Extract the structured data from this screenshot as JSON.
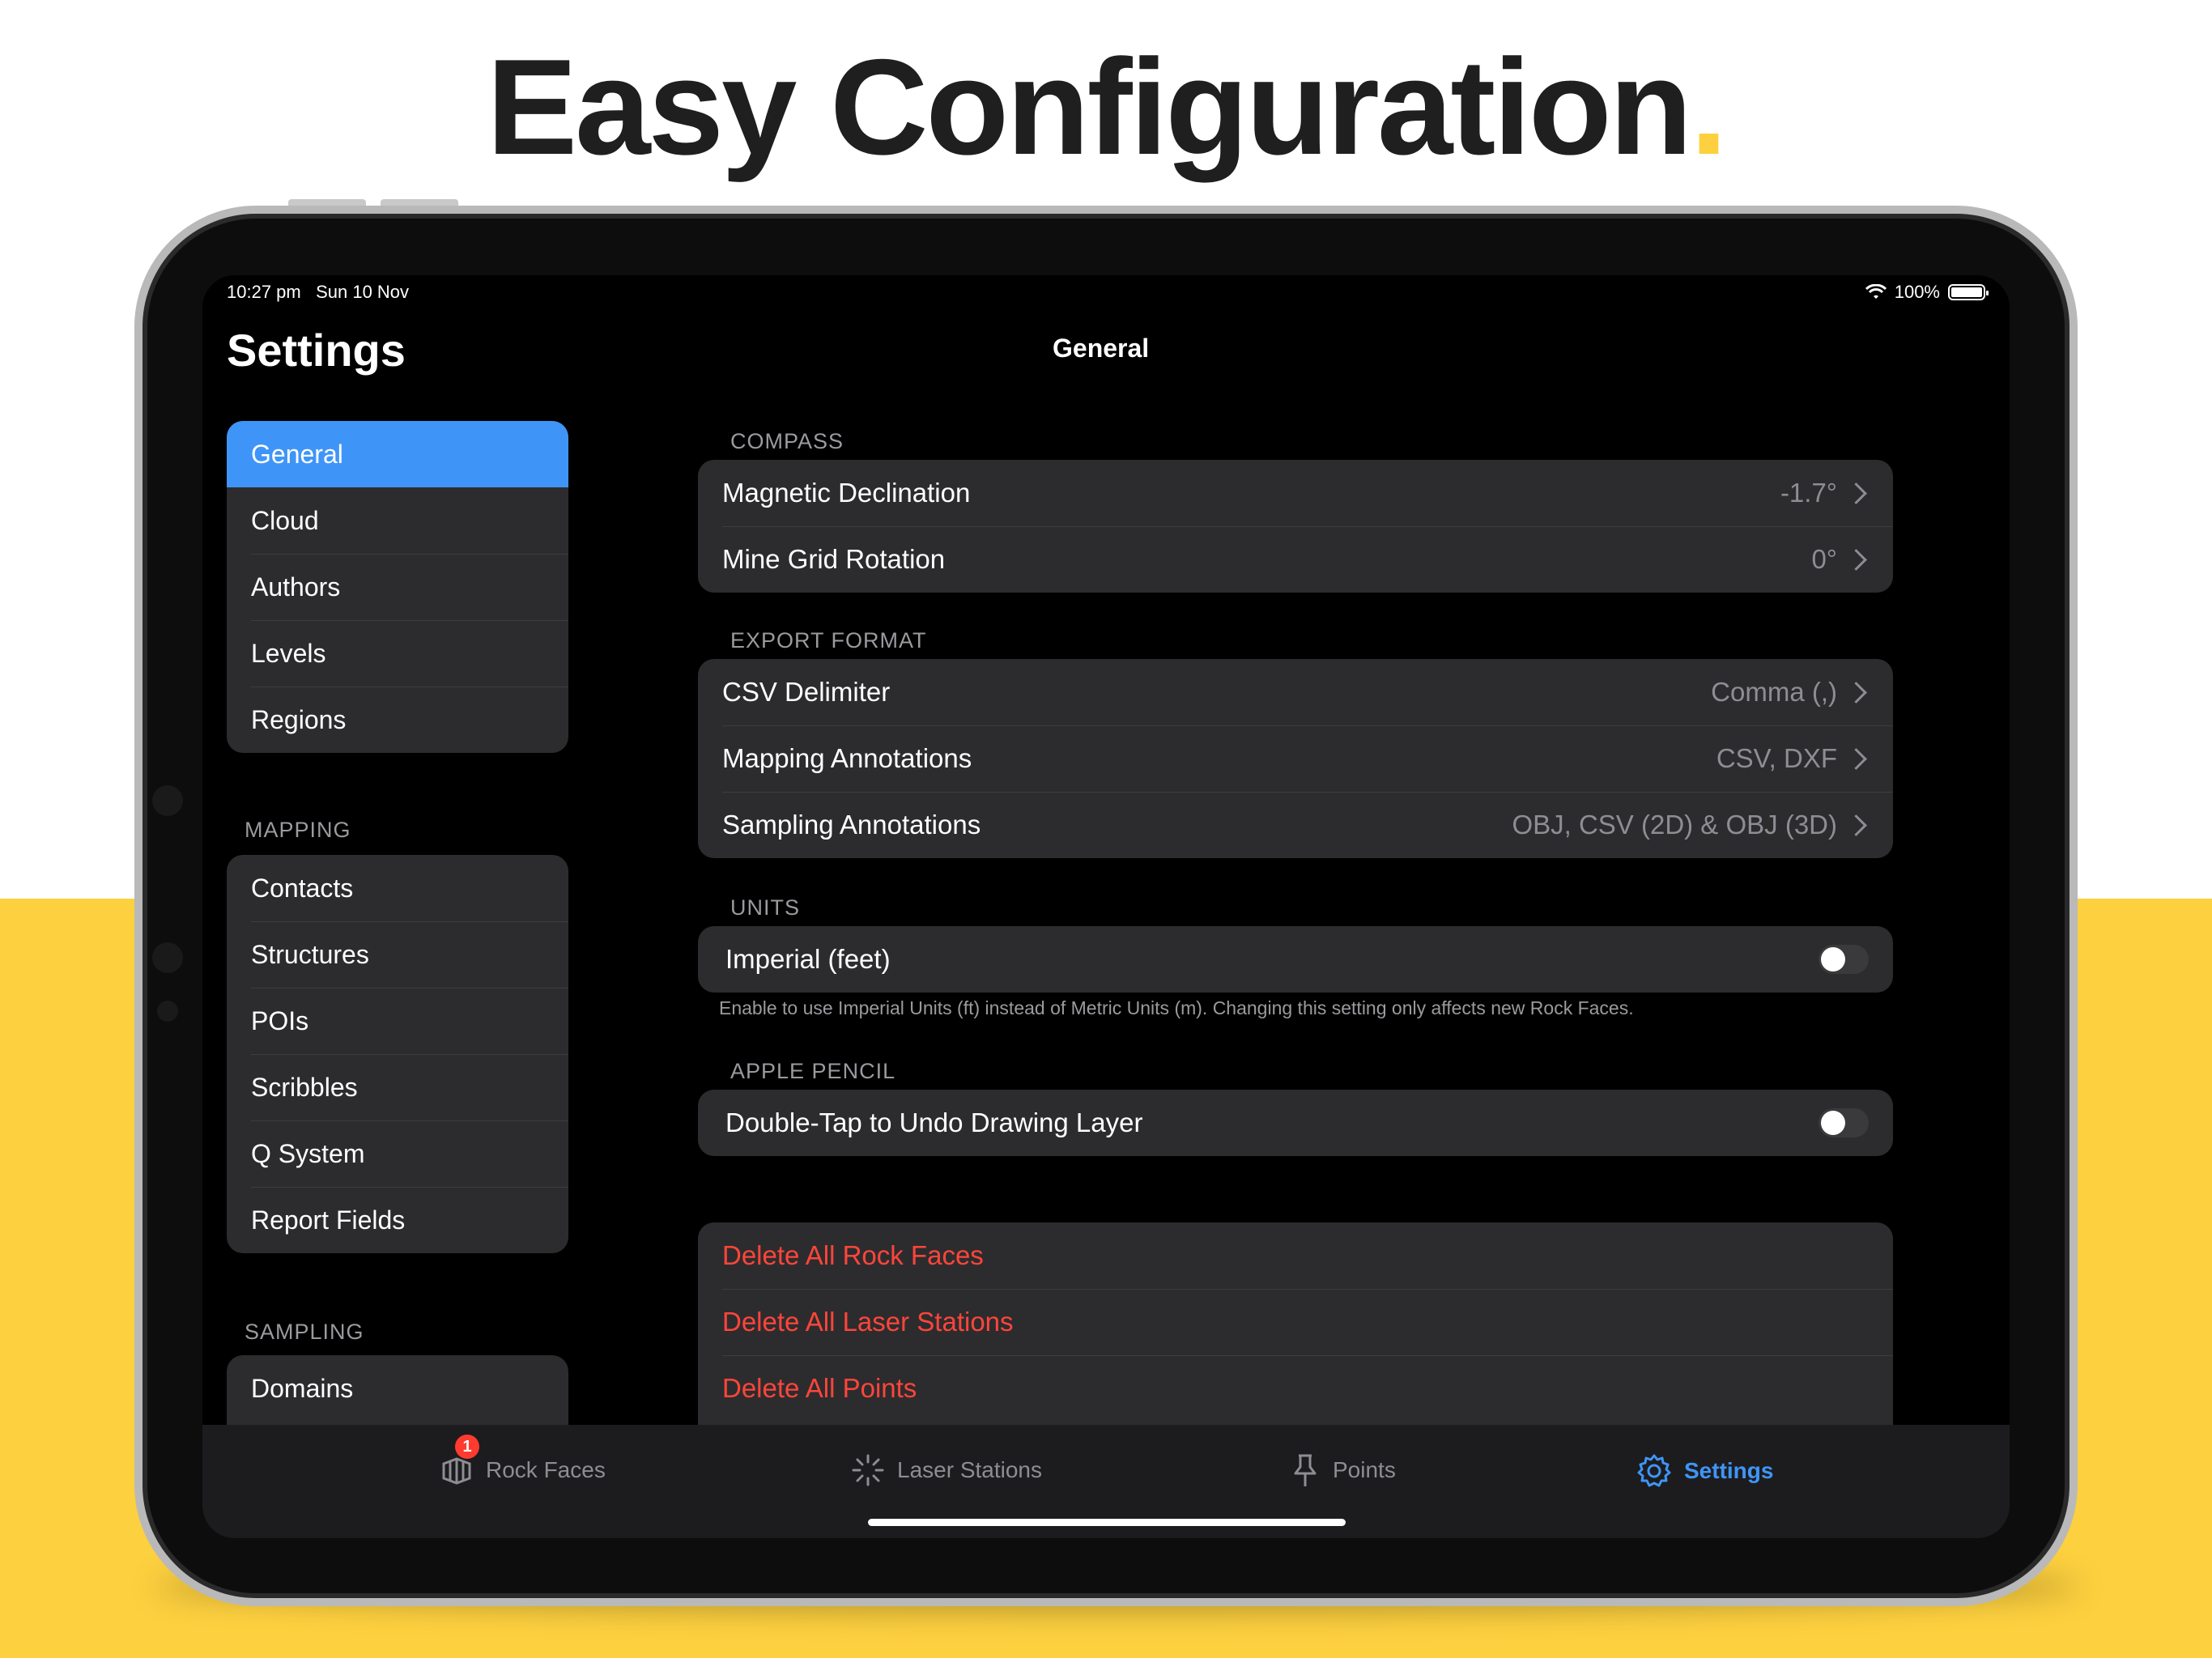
{
  "headline": {
    "text": "Easy Configuration",
    "dot": "."
  },
  "status": {
    "time": "10:27 pm",
    "date": "Sun 10 Nov",
    "battery": "100%"
  },
  "sidebar": {
    "title": "Settings",
    "general_items": [
      "General",
      "Cloud",
      "Authors",
      "Levels",
      "Regions"
    ],
    "mapping_header": "MAPPING",
    "mapping_items": [
      "Contacts",
      "Structures",
      "POIs",
      "Scribbles",
      "Q System",
      "Report Fields"
    ],
    "sampling_header": "SAMPLING",
    "sampling_items": [
      "Domains"
    ]
  },
  "detail": {
    "title": "General",
    "compass": {
      "header": "COMPASS",
      "rows": [
        {
          "label": "Magnetic Declination",
          "value": "-1.7°"
        },
        {
          "label": "Mine Grid Rotation",
          "value": "0°"
        }
      ]
    },
    "export": {
      "header": "EXPORT FORMAT",
      "rows": [
        {
          "label": "CSV Delimiter",
          "value": "Comma (,)"
        },
        {
          "label": "Mapping Annotations",
          "value": "CSV, DXF"
        },
        {
          "label": "Sampling Annotations",
          "value": "OBJ, CSV (2D) & OBJ (3D)"
        }
      ]
    },
    "units": {
      "header": "UNITS",
      "label": "Imperial (feet)",
      "footnote": "Enable to use Imperial Units (ft) instead of Metric Units (m). Changing this setting only affects new Rock Faces."
    },
    "pencil": {
      "header": "APPLE PENCIL",
      "label": "Double-Tap to Undo Drawing Layer"
    },
    "danger": [
      "Delete All Rock Faces",
      "Delete All Laser Stations",
      "Delete All Points"
    ]
  },
  "tabs": {
    "rock_faces": "Rock Faces",
    "rock_faces_badge": "1",
    "laser_stations": "Laser Stations",
    "points": "Points",
    "settings": "Settings"
  }
}
